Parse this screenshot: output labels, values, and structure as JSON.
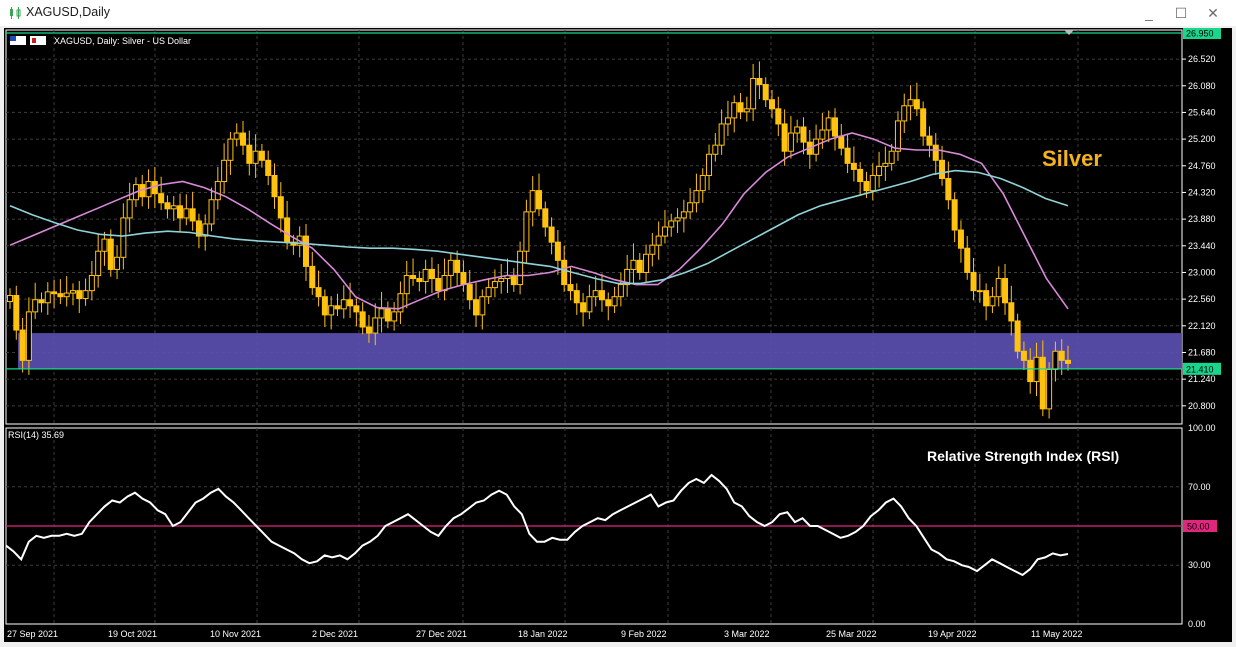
{
  "window": {
    "title": "XAGUSD,Daily",
    "controls": [
      "_",
      "☐",
      "✕"
    ]
  },
  "colors": {
    "background": "#000000",
    "grid": "#3c3c3c",
    "axis_text": "#ffffff",
    "candle_fill": "#ffc20e",
    "ma_fast": "#d989d9",
    "ma_slow": "#8fd3d8",
    "zone": "#5b4fb0",
    "hline": "#18d68d",
    "rsi_line": "#ffffff",
    "rsi_level": "#e0267d",
    "annotation": "#f4b21c"
  },
  "main_panel": {
    "symbol_label": "XAGUSD, Daily:  Silver - US Dollar",
    "annotation": "Silver",
    "price_labels": [
      "26.520",
      "26.080",
      "25.640",
      "25.200",
      "24.760",
      "24.320",
      "23.880",
      "23.440",
      "23.000",
      "22.560",
      "22.120",
      "21.680",
      "21.240",
      "20.800"
    ],
    "top_line_label": "26.950",
    "bottom_line_label": "21.410"
  },
  "rsi_panel": {
    "label": "RSI(14) 35.69",
    "annotation": "Relative Strength Index (RSI)",
    "level_label": "50.00",
    "scale_labels": [
      "100.00",
      "70.00",
      "30.00",
      "0.00"
    ]
  },
  "time_labels": [
    "27 Sep 2021",
    "19 Oct 2021",
    "10 Nov 2021",
    "2 Dec 2021",
    "27 Dec 2021",
    "18 Jan 2022",
    "9 Feb 2022",
    "3 Mar 2022",
    "25 Mar 2022",
    "19 Apr 2022",
    "11 May 2022"
  ],
  "chart_data": [
    {
      "type": "candlestick",
      "title": "XAGUSD, Daily:  Silver - US Dollar",
      "ylim": [
        20.5,
        27.0
      ],
      "horizontal_lines": [
        26.95,
        21.41
      ],
      "support_zone": [
        21.41,
        22.0
      ],
      "series": [
        {
          "values": [
            22.62,
            22.05,
            21.55,
            22.35,
            22.55,
            22.5,
            22.68,
            22.65,
            22.6,
            22.66,
            22.7,
            22.57,
            22.7,
            22.95,
            23.35,
            23.55,
            23.05,
            23.25,
            23.9,
            24.2,
            24.45,
            24.25,
            24.5,
            24.3,
            24.15,
            24.05,
            24.1,
            23.9,
            24.05,
            23.85,
            23.6,
            23.8,
            24.2,
            24.5,
            24.85,
            25.2,
            25.3,
            25.1,
            24.8,
            25.0,
            24.85,
            24.6,
            24.25,
            23.9,
            23.5,
            23.45,
            23.6,
            23.1,
            22.75,
            22.6,
            22.3,
            22.45,
            22.4,
            22.55,
            22.45,
            22.35,
            22.1,
            22.0,
            22.25,
            22.4,
            22.2,
            22.35,
            22.65,
            22.95,
            22.9,
            22.85,
            23.05,
            22.9,
            22.7,
            22.95,
            23.2,
            23.0,
            22.8,
            22.55,
            22.3,
            22.6,
            22.75,
            22.85,
            22.9,
            22.95,
            22.8,
            23.35,
            24.0,
            24.35,
            24.05,
            23.75,
            23.5,
            23.2,
            22.8,
            22.7,
            22.5,
            22.35,
            22.6,
            22.7,
            22.55,
            22.45,
            22.6,
            22.8,
            23.05,
            23.2,
            23.0,
            23.3,
            23.45,
            23.6,
            23.75,
            23.85,
            23.9,
            24.0,
            24.15,
            24.35,
            24.6,
            24.95,
            25.1,
            25.45,
            25.55,
            25.8,
            25.65,
            25.7,
            26.2,
            26.1,
            25.85,
            25.7,
            25.45,
            25.0,
            25.3,
            25.4,
            25.15,
            24.95,
            25.2,
            25.35,
            25.55,
            25.25,
            25.05,
            24.8,
            24.7,
            24.5,
            24.35,
            24.6,
            24.75,
            24.8,
            25.0,
            25.5,
            25.75,
            25.85,
            25.7,
            25.25,
            25.1,
            24.85,
            24.55,
            24.2,
            23.7,
            23.4,
            23.0,
            22.7,
            22.7,
            22.45,
            22.6,
            22.9,
            22.5,
            22.2,
            21.7,
            21.55,
            21.2,
            21.6,
            20.75,
            21.4,
            21.7,
            21.55,
            21.5
          ],
          "name": ""
        }
      ],
      "ma_series": [
        {
          "name": "",
          "values": [
            23.45,
            23.6,
            23.75,
            23.9,
            24.05,
            24.2,
            24.35,
            24.45,
            24.5,
            24.4,
            24.25,
            24.05,
            23.82,
            23.6,
            23.4,
            23.05,
            22.6,
            22.42,
            22.4,
            22.55,
            22.7,
            22.8,
            22.88,
            22.95,
            22.95,
            23.0,
            23.1,
            23.0,
            22.88,
            22.8,
            22.8,
            23.05,
            23.4,
            23.8,
            24.3,
            24.65,
            24.9,
            25.05,
            25.2,
            25.3,
            25.2,
            25.05,
            25.02,
            25.02,
            24.95,
            24.8,
            24.3,
            23.6,
            22.9,
            22.4
          ]
        },
        {
          "name": "",
          "values": [
            24.1,
            23.95,
            23.82,
            23.7,
            23.63,
            23.6,
            23.65,
            23.68,
            23.66,
            23.6,
            23.55,
            23.52,
            23.5,
            23.48,
            23.45,
            23.42,
            23.4,
            23.4,
            23.38,
            23.35,
            23.3,
            23.25,
            23.2,
            23.15,
            23.1,
            23.0,
            22.9,
            22.82,
            22.82,
            22.88,
            23.0,
            23.15,
            23.35,
            23.55,
            23.75,
            23.95,
            24.1,
            24.2,
            24.3,
            24.4,
            24.5,
            24.62,
            24.68,
            24.65,
            24.55,
            24.4,
            24.22,
            24.1
          ]
        }
      ]
    },
    {
      "type": "line",
      "title": "RSI(14) 35.69",
      "ylim": [
        0,
        100
      ],
      "level": 50,
      "series": [
        {
          "name": "",
          "values": [
            40,
            37,
            33,
            42,
            45,
            44,
            45,
            45,
            46,
            45,
            46,
            52,
            56,
            60,
            63,
            62,
            65,
            67,
            64,
            62,
            58,
            56,
            50,
            52,
            57,
            62,
            64,
            67,
            69,
            65,
            62,
            58,
            54,
            50,
            46,
            42,
            40,
            38,
            36,
            33,
            31,
            32,
            35,
            34,
            35,
            33,
            36,
            40,
            42,
            45,
            50,
            52,
            54,
            56,
            53,
            50,
            47,
            45,
            50,
            54,
            56,
            59,
            62,
            63,
            66,
            68,
            66,
            60,
            56,
            46,
            42,
            42,
            44,
            43,
            43,
            47,
            50,
            52,
            54,
            53,
            56,
            58,
            60,
            62,
            64,
            66,
            60,
            62,
            63,
            68,
            72,
            74,
            72,
            76,
            73,
            69,
            62,
            60,
            55,
            52,
            50,
            52,
            56,
            57,
            52,
            54,
            50,
            50,
            48,
            46,
            44,
            45,
            47,
            50,
            55,
            58,
            62,
            64,
            60,
            54,
            50,
            44,
            38,
            36,
            33,
            32,
            30,
            29,
            27,
            30,
            33,
            31,
            29,
            27,
            25,
            28,
            33,
            34,
            36,
            35,
            35.69
          ]
        }
      ]
    }
  ]
}
